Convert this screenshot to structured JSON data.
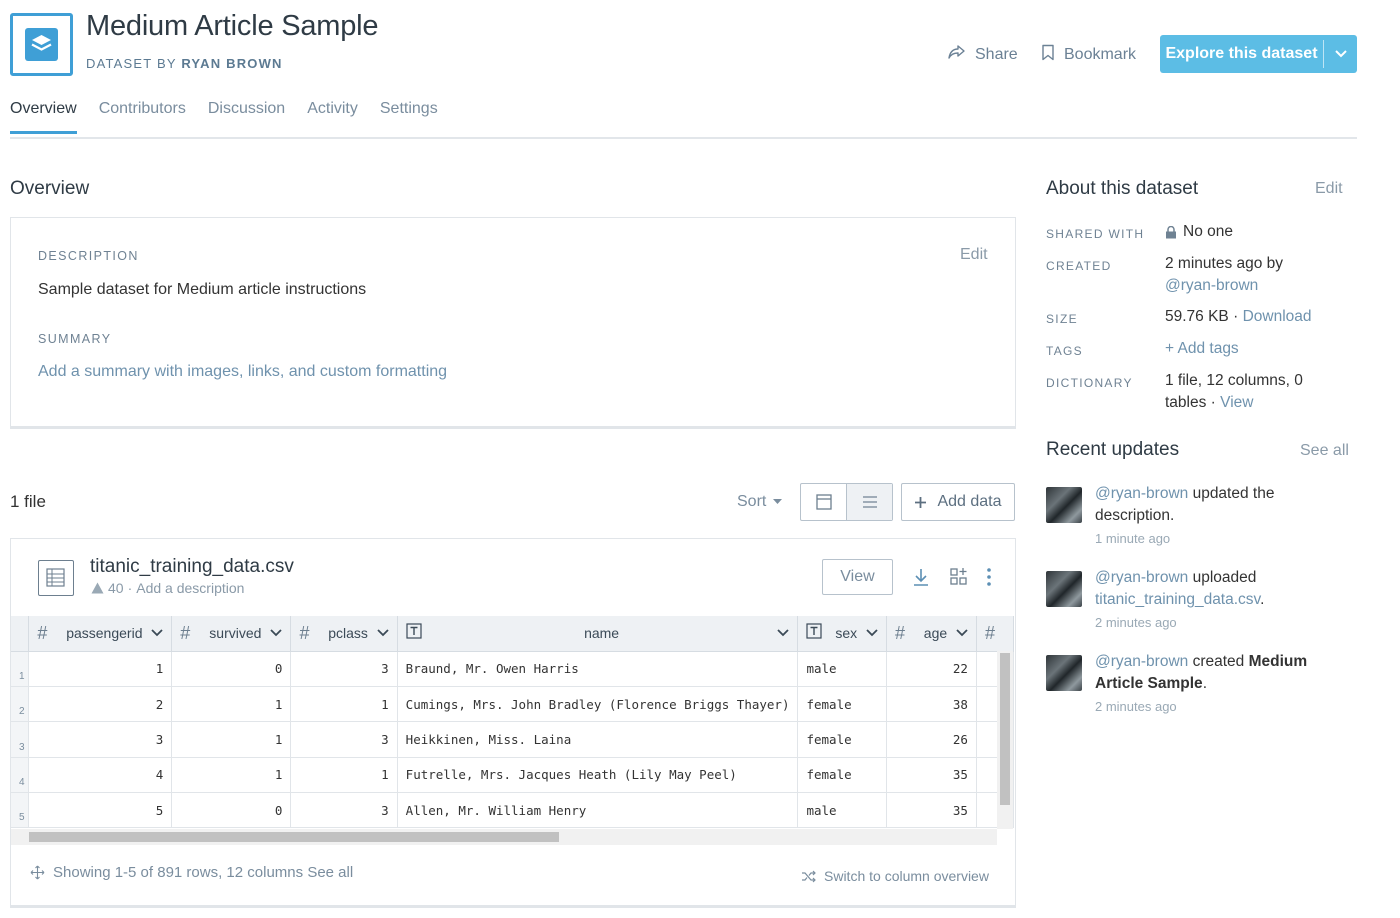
{
  "header": {
    "title": "Medium Article Sample",
    "subtitle_prefix": "DATASET BY ",
    "subtitle_owner": "RYAN BROWN",
    "share_label": "Share",
    "bookmark_label": "Bookmark",
    "explore_label": "Explore this dataset",
    "accent_color": "#5cbde5"
  },
  "tabs": [
    {
      "label": "Overview",
      "active": true
    },
    {
      "label": "Contributors"
    },
    {
      "label": "Discussion"
    },
    {
      "label": "Activity"
    },
    {
      "label": "Settings"
    }
  ],
  "overview": {
    "heading": "Overview",
    "description_label": "DESCRIPTION",
    "edit_label": "Edit",
    "description_text": "Sample dataset for Medium article instructions",
    "summary_label": "SUMMARY",
    "summary_placeholder": "Add a summary with images, links, and custom formatting"
  },
  "files": {
    "count_label": "1 file",
    "sort_label": "Sort",
    "add_data_label": "Add data",
    "file": {
      "name": "titanic_training_data.csv",
      "meta_count": "40",
      "meta_sep": " · ",
      "meta_desc": "Add a description",
      "view_label": "View"
    },
    "columns": [
      {
        "type": "#",
        "name": "passengerid"
      },
      {
        "type": "#",
        "name": "survived"
      },
      {
        "type": "#",
        "name": "pclass"
      },
      {
        "type": "T",
        "name": "name"
      },
      {
        "type": "T",
        "name": "sex"
      },
      {
        "type": "#",
        "name": "age"
      },
      {
        "type": "#",
        "name": ""
      }
    ],
    "rows": [
      {
        "n": "1",
        "cells": [
          "1",
          "0",
          "3",
          "Braund, Mr. Owen Harris",
          "male",
          "22",
          ""
        ]
      },
      {
        "n": "2",
        "cells": [
          "2",
          "1",
          "1",
          "Cumings, Mrs. John Bradley (Florence Briggs Thayer)",
          "female",
          "38",
          ""
        ]
      },
      {
        "n": "3",
        "cells": [
          "3",
          "1",
          "3",
          "Heikkinen, Miss. Laina",
          "female",
          "26",
          ""
        ]
      },
      {
        "n": "4",
        "cells": [
          "4",
          "1",
          "1",
          "Futrelle, Mrs. Jacques Heath (Lily May Peel)",
          "female",
          "35",
          ""
        ]
      },
      {
        "n": "5",
        "cells": [
          "5",
          "0",
          "3",
          "Allen, Mr. William Henry",
          "male",
          "35",
          ""
        ]
      }
    ],
    "showing_text": "Showing 1-5 of 891 rows, 12 columns",
    "see_all_label": "See all",
    "switch_label": "Switch to column overview"
  },
  "about": {
    "heading": "About this dataset",
    "edit_label": "Edit",
    "shared_with_label": "SHARED WITH",
    "shared_with_value": "No one",
    "created_label": "CREATED",
    "created_value": "2 minutes ago by",
    "created_user": "@ryan-brown",
    "size_label": "SIZE",
    "size_value": "59.76 KB",
    "size_sep": " · ",
    "size_download": "Download",
    "tags_label": "TAGS",
    "tags_value": "+ Add tags",
    "dictionary_label": "DICTIONARY",
    "dictionary_value_1": "1 file, 12 columns, 0",
    "dictionary_value_2": "tables",
    "dictionary_sep": " · ",
    "dictionary_view": "View"
  },
  "updates": {
    "heading": "Recent updates",
    "see_all_label": "See all",
    "items": [
      {
        "user": "@ryan-brown",
        "text": " updated the description.",
        "time": "1 minute ago"
      },
      {
        "user": "@ryan-brown",
        "text": " uploaded ",
        "link": "titanic_training_data.csv",
        "suffix": ".",
        "time": "2 minutes ago"
      },
      {
        "user": "@ryan-brown",
        "text": " created ",
        "bold": "Medium Article Sample",
        "suffix": ".",
        "time": "2 minutes ago"
      }
    ]
  }
}
